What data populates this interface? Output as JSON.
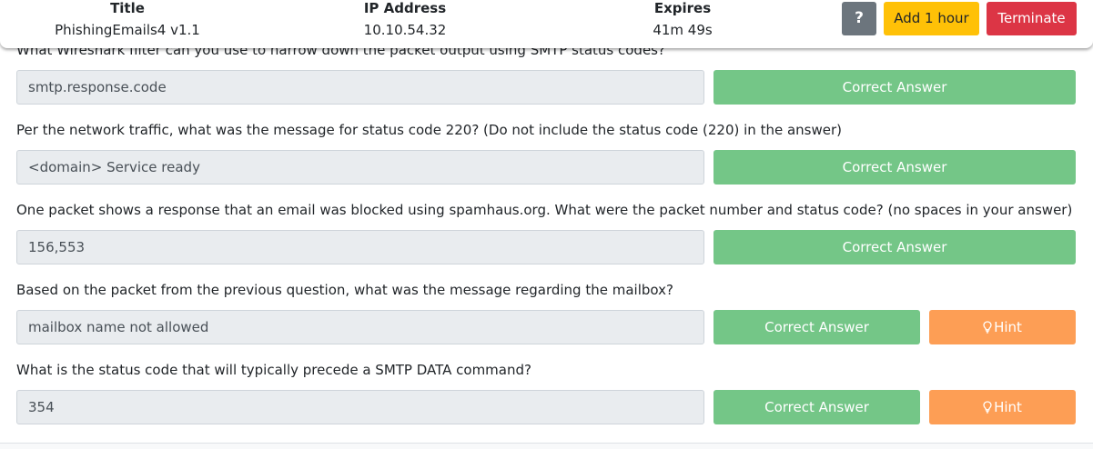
{
  "header": {
    "title_label": "Title",
    "title_value": "PhishingEmails4 v1.1",
    "ip_label": "IP Address",
    "ip_value": "10.10.54.32",
    "expires_label": "Expires",
    "expires_value": "41m 49s",
    "help_label": "?",
    "add_hour_label": "Add 1 hour",
    "terminate_label": "Terminate"
  },
  "questions": [
    {
      "text": "What Wireshark filter can you use to narrow down the packet output using SMTP status codes?",
      "answer": "smtp.response.code",
      "correct_label": "Correct Answer"
    },
    {
      "text": "Per the network traffic, what was the message for status code 220? (Do not include the status code (220) in the answer)",
      "answer": "<domain> Service ready",
      "correct_label": "Correct Answer"
    },
    {
      "text": "One packet shows a response that an email was blocked using spamhaus.org. What were the packet number and status code? (no spaces in your answer)",
      "answer": "156,553",
      "correct_label": "Correct Answer"
    },
    {
      "text": "Based on the packet from the previous question, what was the message regarding the mailbox?",
      "answer": "mailbox name not allowed",
      "correct_label": "Correct Answer",
      "hint_label": "Hint"
    },
    {
      "text": "What is the status code that will typically precede a SMTP DATA command?",
      "answer": "354",
      "correct_label": "Correct Answer",
      "hint_label": "Hint"
    }
  ],
  "colors": {
    "correct": "#74c687",
    "hint": "#fd9e55",
    "terminate": "#dc3545",
    "add_hour": "#ffc107",
    "help": "#6c757d"
  },
  "icons": [
    "lightbulb-icon"
  ]
}
